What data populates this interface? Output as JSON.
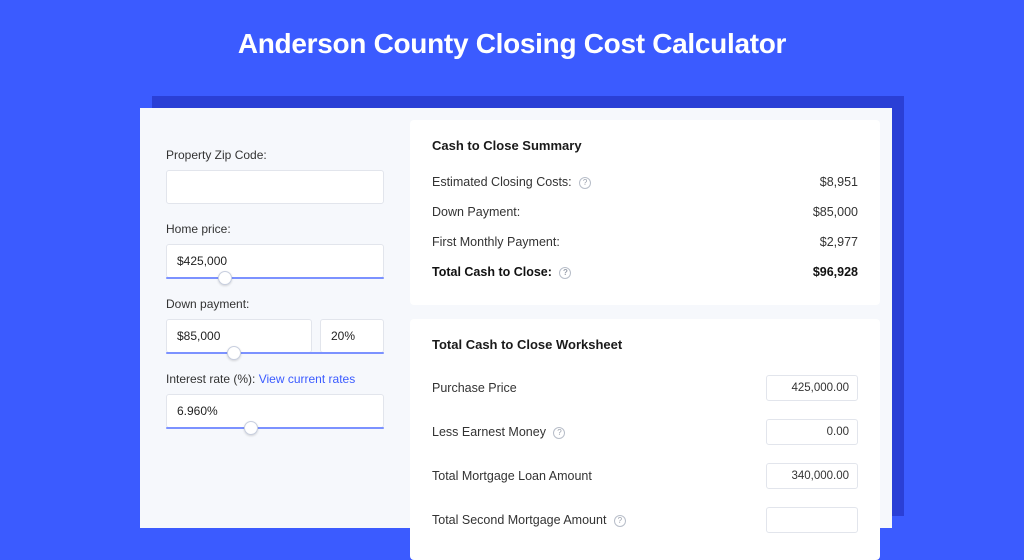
{
  "header": {
    "title": "Anderson County Closing Cost Calculator"
  },
  "form": {
    "zip_label": "Property Zip Code:",
    "zip_value": "",
    "home_price_label": "Home price:",
    "home_price_value": "$425,000",
    "down_payment_label": "Down payment:",
    "down_payment_value": "$85,000",
    "down_payment_pct": "20%",
    "interest_label": "Interest rate (%):",
    "interest_link": "View current rates",
    "interest_value": "6.960%"
  },
  "summary": {
    "heading": "Cash to Close Summary",
    "rows": [
      {
        "label": "Estimated Closing Costs:",
        "help": true,
        "value": "$8,951"
      },
      {
        "label": "Down Payment:",
        "help": false,
        "value": "$85,000"
      },
      {
        "label": "First Monthly Payment:",
        "help": false,
        "value": "$2,977"
      }
    ],
    "total_label": "Total Cash to Close:",
    "total_value": "$96,928"
  },
  "worksheet": {
    "heading": "Total Cash to Close Worksheet",
    "rows": [
      {
        "label": "Purchase Price",
        "help": false,
        "value": "425,000.00"
      },
      {
        "label": "Less Earnest Money",
        "help": true,
        "value": "0.00"
      },
      {
        "label": "Total Mortgage Loan Amount",
        "help": false,
        "value": "340,000.00"
      },
      {
        "label": "Total Second Mortgage Amount",
        "help": true,
        "value": ""
      }
    ]
  },
  "sliders": {
    "home_price_pos": "24%",
    "down_payment_pos": "28%",
    "interest_pos": "36%"
  }
}
